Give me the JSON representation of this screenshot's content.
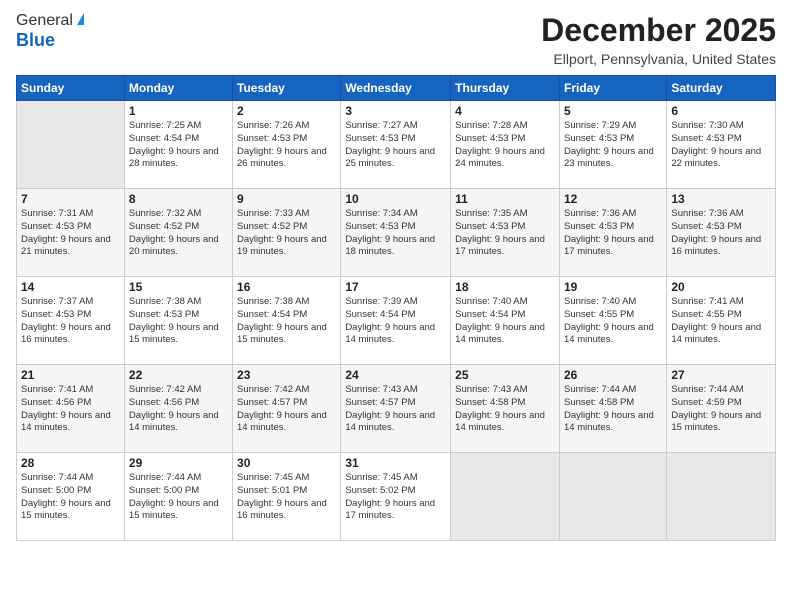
{
  "logo": {
    "general": "General",
    "blue": "Blue"
  },
  "title": "December 2025",
  "location": "Ellport, Pennsylvania, United States",
  "days_header": [
    "Sunday",
    "Monday",
    "Tuesday",
    "Wednesday",
    "Thursday",
    "Friday",
    "Saturday"
  ],
  "weeks": [
    [
      {
        "day": "",
        "sunrise": "",
        "sunset": "",
        "daylight": ""
      },
      {
        "day": "1",
        "sunrise": "Sunrise: 7:25 AM",
        "sunset": "Sunset: 4:54 PM",
        "daylight": "Daylight: 9 hours and 28 minutes."
      },
      {
        "day": "2",
        "sunrise": "Sunrise: 7:26 AM",
        "sunset": "Sunset: 4:53 PM",
        "daylight": "Daylight: 9 hours and 26 minutes."
      },
      {
        "day": "3",
        "sunrise": "Sunrise: 7:27 AM",
        "sunset": "Sunset: 4:53 PM",
        "daylight": "Daylight: 9 hours and 25 minutes."
      },
      {
        "day": "4",
        "sunrise": "Sunrise: 7:28 AM",
        "sunset": "Sunset: 4:53 PM",
        "daylight": "Daylight: 9 hours and 24 minutes."
      },
      {
        "day": "5",
        "sunrise": "Sunrise: 7:29 AM",
        "sunset": "Sunset: 4:53 PM",
        "daylight": "Daylight: 9 hours and 23 minutes."
      },
      {
        "day": "6",
        "sunrise": "Sunrise: 7:30 AM",
        "sunset": "Sunset: 4:53 PM",
        "daylight": "Daylight: 9 hours and 22 minutes."
      }
    ],
    [
      {
        "day": "7",
        "sunrise": "Sunrise: 7:31 AM",
        "sunset": "Sunset: 4:53 PM",
        "daylight": "Daylight: 9 hours and 21 minutes."
      },
      {
        "day": "8",
        "sunrise": "Sunrise: 7:32 AM",
        "sunset": "Sunset: 4:52 PM",
        "daylight": "Daylight: 9 hours and 20 minutes."
      },
      {
        "day": "9",
        "sunrise": "Sunrise: 7:33 AM",
        "sunset": "Sunset: 4:52 PM",
        "daylight": "Daylight: 9 hours and 19 minutes."
      },
      {
        "day": "10",
        "sunrise": "Sunrise: 7:34 AM",
        "sunset": "Sunset: 4:53 PM",
        "daylight": "Daylight: 9 hours and 18 minutes."
      },
      {
        "day": "11",
        "sunrise": "Sunrise: 7:35 AM",
        "sunset": "Sunset: 4:53 PM",
        "daylight": "Daylight: 9 hours and 17 minutes."
      },
      {
        "day": "12",
        "sunrise": "Sunrise: 7:36 AM",
        "sunset": "Sunset: 4:53 PM",
        "daylight": "Daylight: 9 hours and 17 minutes."
      },
      {
        "day": "13",
        "sunrise": "Sunrise: 7:36 AM",
        "sunset": "Sunset: 4:53 PM",
        "daylight": "Daylight: 9 hours and 16 minutes."
      }
    ],
    [
      {
        "day": "14",
        "sunrise": "Sunrise: 7:37 AM",
        "sunset": "Sunset: 4:53 PM",
        "daylight": "Daylight: 9 hours and 16 minutes."
      },
      {
        "day": "15",
        "sunrise": "Sunrise: 7:38 AM",
        "sunset": "Sunset: 4:53 PM",
        "daylight": "Daylight: 9 hours and 15 minutes."
      },
      {
        "day": "16",
        "sunrise": "Sunrise: 7:38 AM",
        "sunset": "Sunset: 4:54 PM",
        "daylight": "Daylight: 9 hours and 15 minutes."
      },
      {
        "day": "17",
        "sunrise": "Sunrise: 7:39 AM",
        "sunset": "Sunset: 4:54 PM",
        "daylight": "Daylight: 9 hours and 14 minutes."
      },
      {
        "day": "18",
        "sunrise": "Sunrise: 7:40 AM",
        "sunset": "Sunset: 4:54 PM",
        "daylight": "Daylight: 9 hours and 14 minutes."
      },
      {
        "day": "19",
        "sunrise": "Sunrise: 7:40 AM",
        "sunset": "Sunset: 4:55 PM",
        "daylight": "Daylight: 9 hours and 14 minutes."
      },
      {
        "day": "20",
        "sunrise": "Sunrise: 7:41 AM",
        "sunset": "Sunset: 4:55 PM",
        "daylight": "Daylight: 9 hours and 14 minutes."
      }
    ],
    [
      {
        "day": "21",
        "sunrise": "Sunrise: 7:41 AM",
        "sunset": "Sunset: 4:56 PM",
        "daylight": "Daylight: 9 hours and 14 minutes."
      },
      {
        "day": "22",
        "sunrise": "Sunrise: 7:42 AM",
        "sunset": "Sunset: 4:56 PM",
        "daylight": "Daylight: 9 hours and 14 minutes."
      },
      {
        "day": "23",
        "sunrise": "Sunrise: 7:42 AM",
        "sunset": "Sunset: 4:57 PM",
        "daylight": "Daylight: 9 hours and 14 minutes."
      },
      {
        "day": "24",
        "sunrise": "Sunrise: 7:43 AM",
        "sunset": "Sunset: 4:57 PM",
        "daylight": "Daylight: 9 hours and 14 minutes."
      },
      {
        "day": "25",
        "sunrise": "Sunrise: 7:43 AM",
        "sunset": "Sunset: 4:58 PM",
        "daylight": "Daylight: 9 hours and 14 minutes."
      },
      {
        "day": "26",
        "sunrise": "Sunrise: 7:44 AM",
        "sunset": "Sunset: 4:58 PM",
        "daylight": "Daylight: 9 hours and 14 minutes."
      },
      {
        "day": "27",
        "sunrise": "Sunrise: 7:44 AM",
        "sunset": "Sunset: 4:59 PM",
        "daylight": "Daylight: 9 hours and 15 minutes."
      }
    ],
    [
      {
        "day": "28",
        "sunrise": "Sunrise: 7:44 AM",
        "sunset": "Sunset: 5:00 PM",
        "daylight": "Daylight: 9 hours and 15 minutes."
      },
      {
        "day": "29",
        "sunrise": "Sunrise: 7:44 AM",
        "sunset": "Sunset: 5:00 PM",
        "daylight": "Daylight: 9 hours and 15 minutes."
      },
      {
        "day": "30",
        "sunrise": "Sunrise: 7:45 AM",
        "sunset": "Sunset: 5:01 PM",
        "daylight": "Daylight: 9 hours and 16 minutes."
      },
      {
        "day": "31",
        "sunrise": "Sunrise: 7:45 AM",
        "sunset": "Sunset: 5:02 PM",
        "daylight": "Daylight: 9 hours and 17 minutes."
      },
      {
        "day": "",
        "sunrise": "",
        "sunset": "",
        "daylight": ""
      },
      {
        "day": "",
        "sunrise": "",
        "sunset": "",
        "daylight": ""
      },
      {
        "day": "",
        "sunrise": "",
        "sunset": "",
        "daylight": ""
      }
    ]
  ]
}
